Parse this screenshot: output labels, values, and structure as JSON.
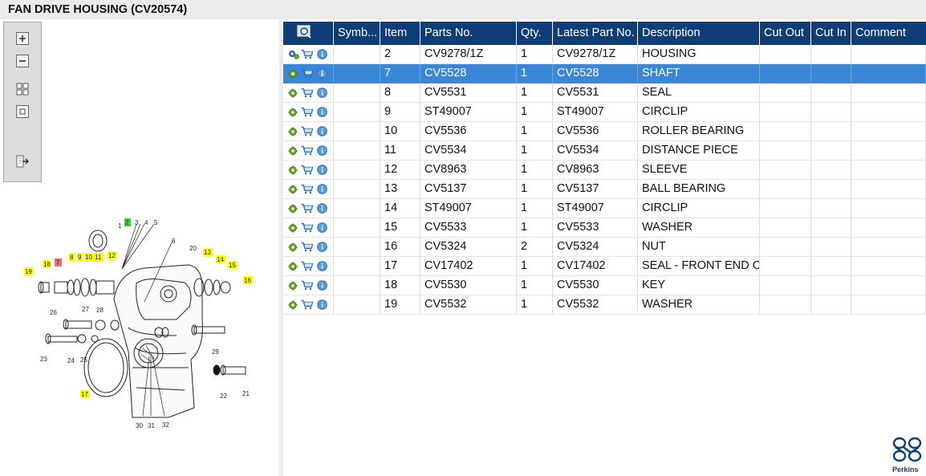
{
  "window": {
    "title": "FAN DRIVE HOUSING (CV20574)"
  },
  "toolbar": {
    "buttons": [
      {
        "name": "zoom-in-icon"
      },
      {
        "name": "zoom-out-icon"
      },
      {
        "name": "fit-all-icon"
      },
      {
        "name": "actual-size-icon"
      },
      {
        "name": "export-icon"
      }
    ]
  },
  "diagram": {
    "callouts": [
      "1",
      "2",
      "3",
      "4",
      "5",
      "6",
      "7",
      "8",
      "9",
      "10",
      "11",
      "12",
      "13",
      "14",
      "15",
      "16",
      "17",
      "18",
      "19",
      "20",
      "21",
      "22",
      "23",
      "24",
      "25",
      "26",
      "27",
      "28",
      "29",
      "30",
      "31",
      "32"
    ],
    "highlighted": [
      "8",
      "9",
      "10",
      "11",
      "12",
      "13",
      "14",
      "15",
      "16",
      "17",
      "18",
      "19"
    ],
    "selected_callout": "7",
    "current_callout": "2"
  },
  "table": {
    "headers": {
      "symbol": "Symb...",
      "item": "Item",
      "parts_no": "Parts No.",
      "qty": "Qty.",
      "latest": "Latest Part No.",
      "description": "Description",
      "cut_out": "Cut Out",
      "cut_in": "Cut In",
      "comment": "Comment"
    },
    "rows": [
      {
        "item": "2",
        "parts_no": "CV9278/1Z",
        "qty": "1",
        "latest": "CV9278/1Z",
        "description": "HOUSING"
      },
      {
        "item": "7",
        "parts_no": "CV5528",
        "qty": "1",
        "latest": "CV5528",
        "description": "SHAFT",
        "selected": true
      },
      {
        "item": "8",
        "parts_no": "CV5531",
        "qty": "1",
        "latest": "CV5531",
        "description": "SEAL"
      },
      {
        "item": "9",
        "parts_no": "ST49007",
        "qty": "1",
        "latest": "ST49007",
        "description": "CIRCLIP"
      },
      {
        "item": "10",
        "parts_no": "CV5536",
        "qty": "1",
        "latest": "CV5536",
        "description": "ROLLER BEARING"
      },
      {
        "item": "11",
        "parts_no": "CV5534",
        "qty": "1",
        "latest": "CV5534",
        "description": "DISTANCE PIECE"
      },
      {
        "item": "12",
        "parts_no": "CV8963",
        "qty": "1",
        "latest": "CV8963",
        "description": "SLEEVE"
      },
      {
        "item": "13",
        "parts_no": "CV5137",
        "qty": "1",
        "latest": "CV5137",
        "description": "BALL BEARING"
      },
      {
        "item": "14",
        "parts_no": "ST49007",
        "qty": "1",
        "latest": "ST49007",
        "description": "CIRCLIP"
      },
      {
        "item": "15",
        "parts_no": "CV5533",
        "qty": "1",
        "latest": "CV5533",
        "description": "WASHER"
      },
      {
        "item": "16",
        "parts_no": "CV5324",
        "qty": "2",
        "latest": "CV5324",
        "description": "NUT"
      },
      {
        "item": "17",
        "parts_no": "CV17402",
        "qty": "1",
        "latest": "CV17402",
        "description": "SEAL - FRONT END OI"
      },
      {
        "item": "18",
        "parts_no": "CV5530",
        "qty": "1",
        "latest": "CV5530",
        "description": "KEY"
      },
      {
        "item": "19",
        "parts_no": "CV5532",
        "qty": "1",
        "latest": "CV5532",
        "description": "WASHER"
      }
    ]
  },
  "row_icons": [
    "gear-icon",
    "cart-icon",
    "info-icon"
  ],
  "brand": {
    "name": "Perkins",
    "color": "#0f3d78"
  },
  "colors": {
    "header": "#0f3d78",
    "selection": "#3b86d6",
    "highlight": "#ffff00",
    "selected_callout": "#f26d6d",
    "current_callout": "#33cc33"
  }
}
